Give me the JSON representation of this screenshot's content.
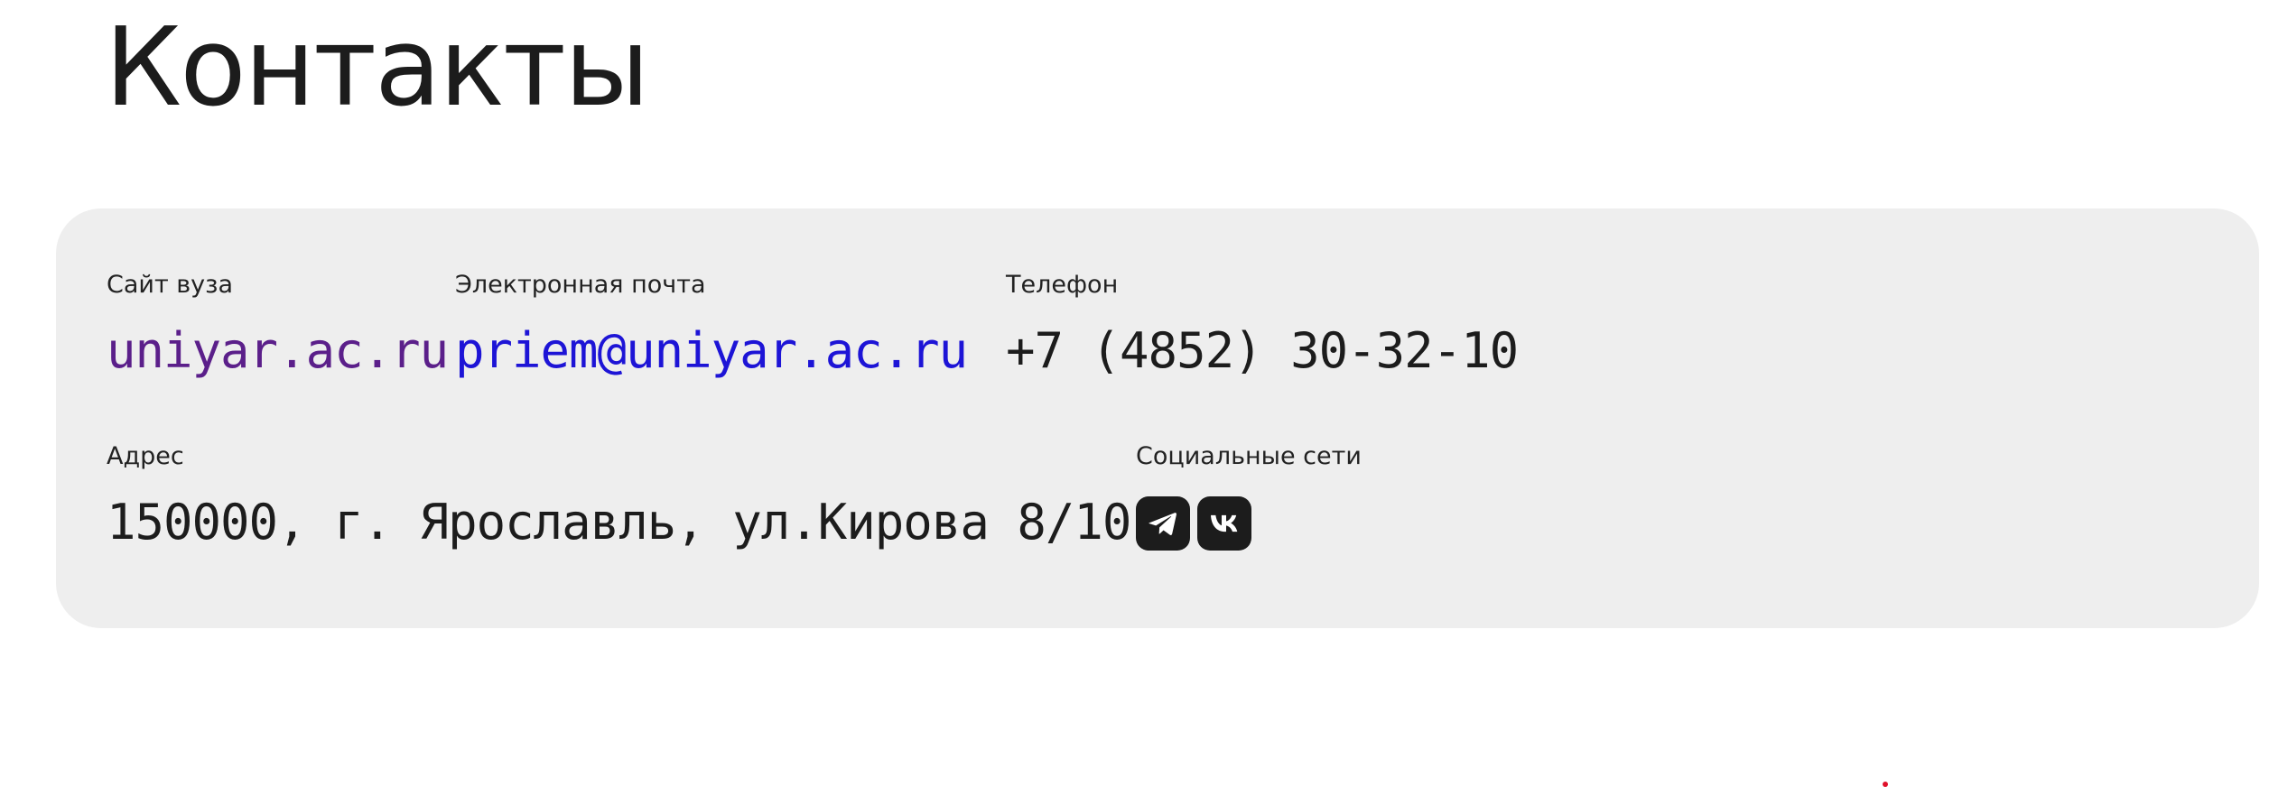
{
  "page": {
    "title": "Контакты"
  },
  "contacts": {
    "site": {
      "label": "Сайт вуза",
      "value": "uniyar.ac.ru"
    },
    "email": {
      "label": "Электронная почта",
      "value": "priem@uniyar.ac.ru"
    },
    "phone": {
      "label": "Телефон",
      "value": "+7 (4852) 30-32-10"
    },
    "address": {
      "label": "Адрес",
      "value": "150000, г. Ярославль, ул.Кирова 8/10."
    },
    "social": {
      "label": "Социальные сети",
      "links": [
        {
          "icon": "telegram-icon"
        },
        {
          "icon": "vk-icon"
        }
      ]
    }
  },
  "colors": {
    "card_background": "#eeeeee",
    "visited_link": "#5b1f8a",
    "email_link": "#1d14d6",
    "text": "#1c1c1c",
    "social_button": "#1c1c1c"
  }
}
